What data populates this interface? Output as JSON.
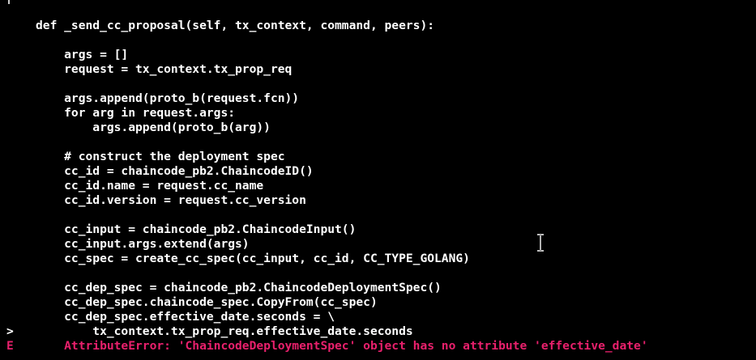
{
  "terminal": {
    "lines": [
      {
        "marker": "",
        "text": "def _send_cc_proposal(self, tx_context, command, peers):",
        "error": false
      },
      {
        "marker": "",
        "text": "",
        "error": false
      },
      {
        "marker": "",
        "text": "    args = []",
        "error": false
      },
      {
        "marker": "",
        "text": "    request = tx_context.tx_prop_req",
        "error": false
      },
      {
        "marker": "",
        "text": "",
        "error": false
      },
      {
        "marker": "",
        "text": "    args.append(proto_b(request.fcn))",
        "error": false
      },
      {
        "marker": "",
        "text": "    for arg in request.args:",
        "error": false
      },
      {
        "marker": "",
        "text": "        args.append(proto_b(arg))",
        "error": false
      },
      {
        "marker": "",
        "text": "",
        "error": false
      },
      {
        "marker": "",
        "text": "    # construct the deployment spec",
        "error": false
      },
      {
        "marker": "",
        "text": "    cc_id = chaincode_pb2.ChaincodeID()",
        "error": false
      },
      {
        "marker": "",
        "text": "    cc_id.name = request.cc_name",
        "error": false
      },
      {
        "marker": "",
        "text": "    cc_id.version = request.cc_version",
        "error": false
      },
      {
        "marker": "",
        "text": "",
        "error": false
      },
      {
        "marker": "",
        "text": "    cc_input = chaincode_pb2.ChaincodeInput()",
        "error": false
      },
      {
        "marker": "",
        "text": "    cc_input.args.extend(args)",
        "error": false
      },
      {
        "marker": "",
        "text": "    cc_spec = create_cc_spec(cc_input, cc_id, CC_TYPE_GOLANG)",
        "error": false
      },
      {
        "marker": "",
        "text": "",
        "error": false
      },
      {
        "marker": "",
        "text": "    cc_dep_spec = chaincode_pb2.ChaincodeDeploymentSpec()",
        "error": false
      },
      {
        "marker": "",
        "text": "    cc_dep_spec.chaincode_spec.CopyFrom(cc_spec)",
        "error": false
      },
      {
        "marker": "",
        "text": "    cc_dep_spec.effective_date.seconds = \\",
        "error": false
      },
      {
        "marker": ">",
        "text": "        tx_context.tx_prop_req.effective_date.seconds",
        "error": false
      },
      {
        "marker": "E",
        "text": "    AttributeError: 'ChaincodeDeploymentSpec' object has no attribute 'effective_date'",
        "error": true
      }
    ]
  },
  "colors": {
    "background": "#000000",
    "text": "#ffffff",
    "error": "#e8206c"
  },
  "icons": {
    "cursor": "ibeam-cursor-icon"
  }
}
